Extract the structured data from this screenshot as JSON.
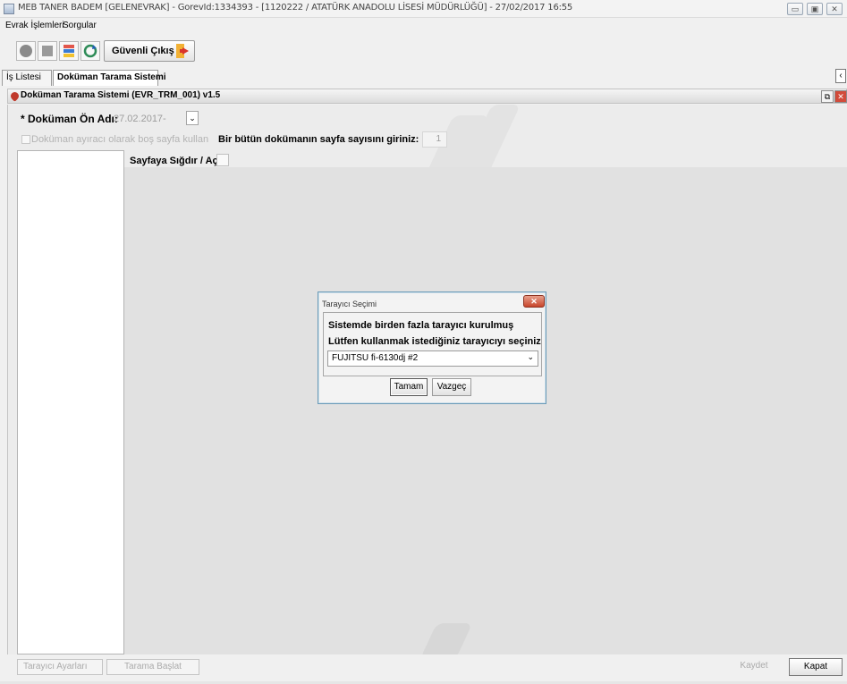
{
  "window": {
    "title": "MEB  TANER BADEM  [GELENEVRAK] - GorevId:1334393 - [1120222 / ATATÜRK ANADOLU LİSESİ MÜDÜRLÜĞÜ] - 27/02/2017 16:55",
    "controls": [
      "minimize",
      "maximize",
      "close"
    ]
  },
  "menu": {
    "items": [
      "Evrak İşlemleri",
      "Sorgular"
    ]
  },
  "toolbar": {
    "icons": [
      "record-icon",
      "stop-icon",
      "notes-icon",
      "refresh-icon"
    ],
    "exit_label": "Güvenli Çıkış",
    "exit_icon": "exit-door-icon"
  },
  "tabs": [
    {
      "label": "İş Listesi",
      "active": false
    },
    {
      "label": "Doküman Tarama Sistemi",
      "active": true
    }
  ],
  "frame": {
    "title": "Doküman Tarama Sistemi (EVR_TRM_001) v1.5"
  },
  "form": {
    "doc_name_label": "* Doküman Ön Adı:",
    "doc_name_value": "27.02.2017-",
    "separator_label": "Doküman ayıracı olarak boş sayfa kullan",
    "page_count_label": "Bir bütün dokümanın sayfa sayısını giriniz:",
    "page_count_value": "1",
    "fit_label": "Sayfaya Sığdır / Aç"
  },
  "dialog": {
    "title": "Tarayıcı Seçimi",
    "line1": "Sistemde birden fazla tarayıcı kurulmuş",
    "line2": "Lütfen kullanmak istediğiniz tarayıcıyı seçiniz",
    "selected_scanner": "FUJITSU fi-6130dj #2",
    "ok_label": "Tamam",
    "cancel_label": "Vazgeç"
  },
  "bottom": {
    "scanner_settings_label": "Tarayıcı Ayarları",
    "start_scan_label": "Tarama Başlat",
    "save_label": "Kaydet",
    "close_label": "Kapat"
  },
  "colors": {
    "dialog_border": "#6b9bb8",
    "close_red": "#c7452b",
    "logo_red": "#c0392b"
  }
}
